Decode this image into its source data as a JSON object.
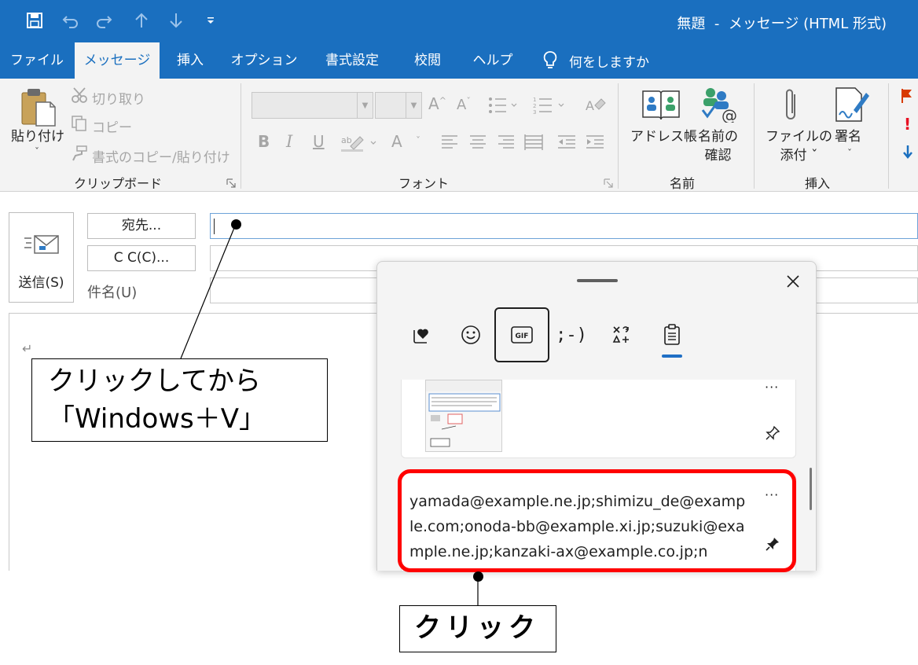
{
  "window": {
    "title": "無題  -  メッセージ (HTML 形式)"
  },
  "tabs": [
    {
      "label": "ファイル"
    },
    {
      "label": "メッセージ",
      "active": true
    },
    {
      "label": "挿入"
    },
    {
      "label": "オプション"
    },
    {
      "label": "書式設定"
    },
    {
      "label": "校閲"
    },
    {
      "label": "ヘルプ"
    }
  ],
  "tell_me": "何をしますか",
  "ribbon": {
    "clipboard": {
      "paste": "貼り付け",
      "cut": "切り取り",
      "copy": "コピー",
      "format_painter": "書式のコピー/貼り付け",
      "label": "クリップボード"
    },
    "font": {
      "label": "フォント",
      "bold": "B",
      "italic": "I",
      "underline": "U",
      "font_color": "A"
    },
    "names": {
      "address_book": "アドレス帳",
      "check_names_line1": "名前の",
      "check_names_line2": "確認",
      "label": "名前"
    },
    "include": {
      "attach_line1": "ファイルの",
      "attach_line2": "添付 ˇ",
      "signature": "署名",
      "label": "挿入"
    }
  },
  "compose": {
    "send": "送信(S)",
    "to": "宛先...",
    "cc": "C C(C)...",
    "subject": "件名(U)",
    "to_value": "",
    "body_mark": "↵"
  },
  "clipboard_panel": {
    "tabs": [
      "favorites-icon",
      "emoji-icon",
      "GIF",
      ";-)",
      "symbols-icon",
      "clipboard-icon"
    ],
    "gif_label": "GIF",
    "kaomoji_label": ";-)",
    "item_text": "yamada@example.ne.jp;shimizu_de@example.com;onoda-bb@example.xi.jp;suzuki@example.ne.jp;kanzaki-ax@example.co.jp;n",
    "more": "···"
  },
  "annotations": {
    "callout1": "クリックしてから\n「Windows＋V」",
    "callout2": "クリック"
  },
  "colors": {
    "brand": "#1a6fbf",
    "highlight": "#ff0000"
  }
}
